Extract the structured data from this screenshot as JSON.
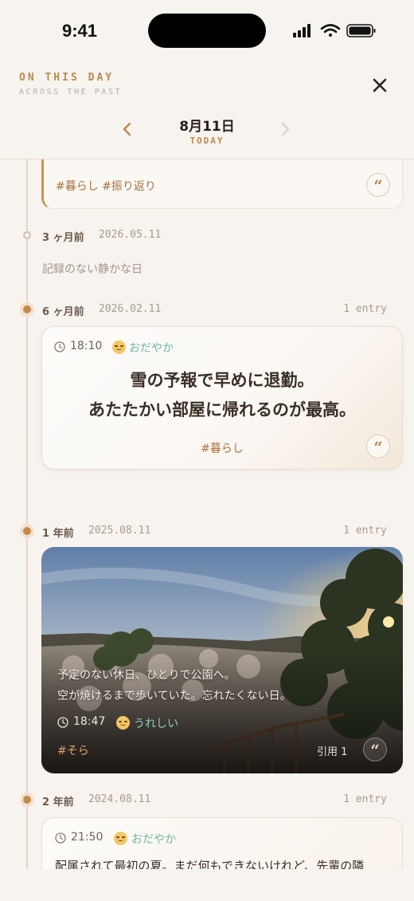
{
  "status_bar": {
    "time": "9:41"
  },
  "header": {
    "brand": "ON THIS DAY",
    "brand_sub": "ACROSS THE PAST",
    "date": "8月11日",
    "date_sub": "TODAY"
  },
  "top_entry": {
    "tags": "#暮らし  #振り返り"
  },
  "sections": [
    {
      "label": "3 ヶ月前",
      "date": "2026.05.11",
      "empty_text": "記録のない静かな日"
    },
    {
      "label": "6 ヶ月前",
      "date": "2026.02.11",
      "count": "1 entry",
      "entry": {
        "time": "18:10",
        "mood": "おだやか",
        "line1": "雪の予報で早めに退勤。",
        "line2": "あたたかい部屋に帰れるのが最高。",
        "tags": "#暮らし"
      }
    },
    {
      "label": "1 年前",
      "date": "2025.08.11",
      "count": "1 entry",
      "entry": {
        "line1": "予定のない休日、ひとりで公園へ。",
        "line2": "空が焼けるまで歩いていた。忘れたくない日。",
        "time": "18:47",
        "mood": "うれしい",
        "tags": "#そら",
        "cite": "引用 1"
      }
    },
    {
      "label": "2 年前",
      "date": "2024.08.11",
      "count": "1 entry",
      "entry": {
        "time": "21:50",
        "mood": "おだやか",
        "text": "配属されて最初の夏。まだ何もできないけれど、先輩の隣"
      }
    }
  ]
}
